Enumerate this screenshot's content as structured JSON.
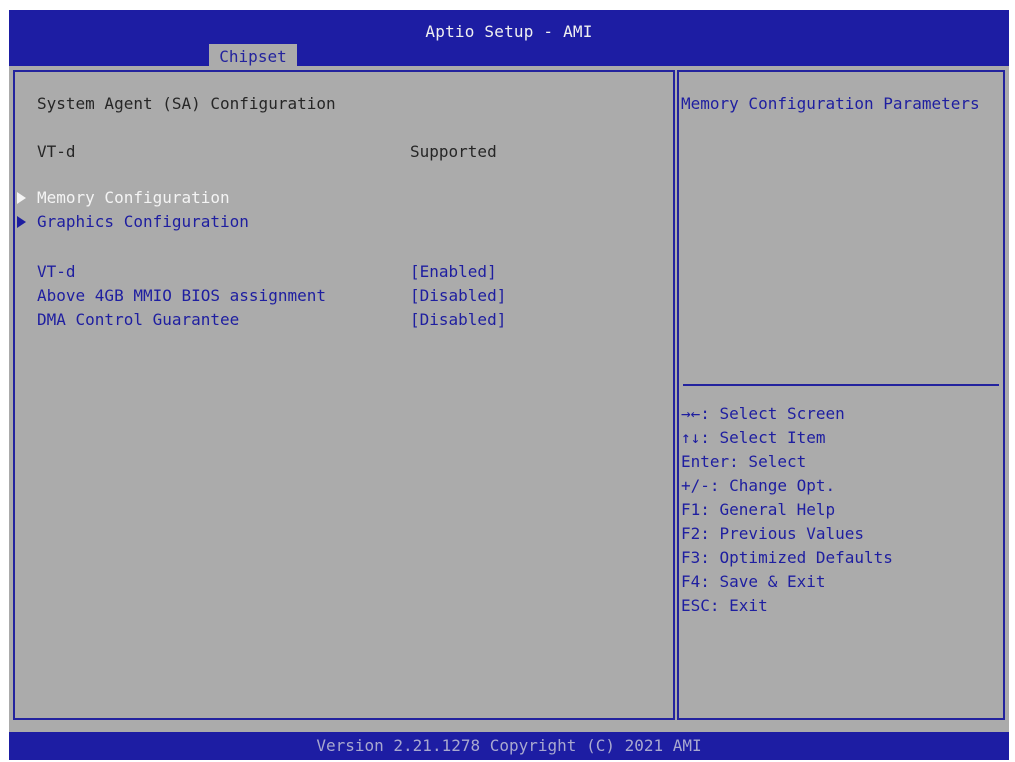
{
  "header": {
    "title": "Aptio Setup - AMI",
    "tab": "Chipset"
  },
  "left": {
    "section_title": "System Agent (SA) Configuration",
    "vtd_info": {
      "label": "VT-d",
      "value": "Supported"
    },
    "submenus": [
      {
        "label": "Memory Configuration",
        "selected": true
      },
      {
        "label": "Graphics Configuration",
        "selected": false
      }
    ],
    "options": [
      {
        "label": "VT-d",
        "value": "[Enabled]"
      },
      {
        "label": "Above 4GB MMIO BIOS assignment",
        "value": "[Disabled]"
      },
      {
        "label": "DMA Control Guarantee",
        "value": "[Disabled]"
      }
    ]
  },
  "help": {
    "description": "Memory Configuration Parameters",
    "keys": [
      "→←: Select Screen",
      "↑↓: Select Item",
      "Enter: Select",
      "+/-: Change Opt.",
      "F1: General Help",
      "F2: Previous Values",
      "F3: Optimized Defaults",
      "F4: Save & Exit",
      "ESC: Exit"
    ]
  },
  "footer": {
    "version": "Version 2.21.1278 Copyright (C) 2021 AMI"
  },
  "colors": {
    "bar_blue": "#1d1da3",
    "panel_gray": "#ababab",
    "text_blue": "#1e1ea0",
    "text_highlight": "#f4f4f4",
    "text_dark": "#262626"
  }
}
